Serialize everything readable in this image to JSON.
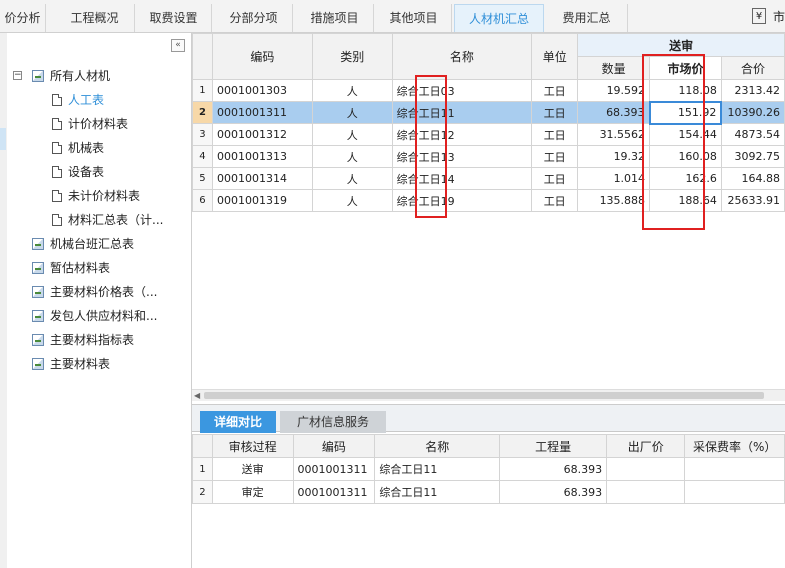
{
  "tabs": [
    {
      "label": "价分析",
      "active": false
    },
    {
      "label": "工程概况",
      "active": false
    },
    {
      "label": "取费设置",
      "active": false
    },
    {
      "label": "分部分项",
      "active": false
    },
    {
      "label": "措施项目",
      "active": false
    },
    {
      "label": "其他项目",
      "active": false
    },
    {
      "label": "人材机汇总",
      "active": true
    },
    {
      "label": "费用汇总",
      "active": false
    }
  ],
  "currency_icon": "¥",
  "currency_label": "市",
  "tree": {
    "collapse_glyph": "«",
    "root_toggle": "−",
    "root": "所有人材机",
    "children": [
      "人工表",
      "计价材料表",
      "机械表",
      "设备表",
      "未计价材料表",
      "材料汇总表（计..."
    ],
    "others": [
      "机械台班汇总表",
      "暂估材料表",
      "主要材料价格表（...",
      "发包人供应材料和...",
      "主要材料指标表",
      "主要材料表"
    ]
  },
  "grid": {
    "headers": {
      "code": "编码",
      "category": "类别",
      "name": "名称",
      "unit": "单位",
      "group": "送审",
      "qty": "数量",
      "price": "市场价",
      "total": "合价"
    },
    "rows": [
      {
        "idx": "1",
        "code": "0001001303",
        "cat": "人",
        "name": "综合工日03",
        "unit": "工日",
        "qty": "19.592",
        "price": "118.08",
        "total": "2313.42"
      },
      {
        "idx": "2",
        "code": "0001001311",
        "cat": "人",
        "name": "综合工日11",
        "unit": "工日",
        "qty": "68.393",
        "price": "151.92",
        "total": "10390.26"
      },
      {
        "idx": "3",
        "code": "0001001312",
        "cat": "人",
        "name": "综合工日12",
        "unit": "工日",
        "qty": "31.5562",
        "price": "154.44",
        "total": "4873.54"
      },
      {
        "idx": "4",
        "code": "0001001313",
        "cat": "人",
        "name": "综合工日13",
        "unit": "工日",
        "qty": "19.32",
        "price": "160.08",
        "total": "3092.75"
      },
      {
        "idx": "5",
        "code": "0001001314",
        "cat": "人",
        "name": "综合工日14",
        "unit": "工日",
        "qty": "1.014",
        "price": "162.6",
        "total": "164.88"
      },
      {
        "idx": "6",
        "code": "0001001319",
        "cat": "人",
        "name": "综合工日19",
        "unit": "工日",
        "qty": "135.888",
        "price": "188.64",
        "total": "25633.91"
      }
    ],
    "selected_row": 2
  },
  "bottom": {
    "tabs": [
      "详细对比",
      "广材信息服务"
    ],
    "headers": {
      "process": "审核过程",
      "code": "编码",
      "name": "名称",
      "qty": "工程量",
      "factory": "出厂价",
      "rate": "采保费率（%）"
    },
    "rows": [
      {
        "idx": "1",
        "process": "送审",
        "code": "0001001311",
        "name": "综合工日11",
        "qty": "68.393",
        "factory": "",
        "rate": ""
      },
      {
        "idx": "2",
        "process": "审定",
        "code": "0001001311",
        "name": "综合工日11",
        "qty": "68.393",
        "factory": "",
        "rate": ""
      }
    ]
  }
}
